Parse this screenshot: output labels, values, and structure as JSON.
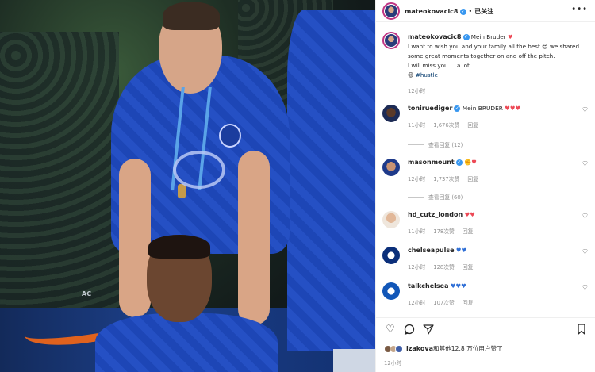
{
  "post": {
    "author": "mateokovacic8",
    "follow_status": "已关注",
    "dot": "•",
    "caption_lines": [
      "Mein Bruder",
      "I want to wish you and your family all the best",
      "we shared some great moments together on and off the pitch.",
      "I will miss you ... a lot"
    ],
    "hashtag": "#hustle",
    "caption_time": "12小时",
    "photo_watermark": "AC"
  },
  "comments": [
    {
      "user": "toniruediger",
      "verified": true,
      "text": "Mein BRUDER",
      "emoji": "♥♥♥",
      "emoji_color": "#ed4956",
      "time": "11小时",
      "likes": "1,676次赞",
      "reply": "回复",
      "view_replies": "查看回复 (12)"
    },
    {
      "user": "masonmount",
      "verified": true,
      "text": "",
      "emoji": "✊♥",
      "emoji_color": "#ed4956",
      "time": "12小时",
      "likes": "1,737次赞",
      "reply": "回复",
      "view_replies": "查看回复 (60)"
    },
    {
      "user": "hd_cutz_london",
      "verified": false,
      "text": "",
      "emoji": "♥♥",
      "emoji_color": "#ed4956",
      "time": "11小时",
      "likes": "178次赞",
      "reply": "回复"
    },
    {
      "user": "chelseapulse",
      "verified": false,
      "text": "",
      "emoji": "♥♥",
      "emoji_color": "#2f6fd6",
      "time": "12小时",
      "likes": "128次赞",
      "reply": "回复"
    },
    {
      "user": "talkchelsea",
      "verified": false,
      "text": "",
      "emoji": "♥♥♥",
      "emoji_color": "#2f6fd6",
      "time": "12小时",
      "likes": "107次赞",
      "reply": "回复"
    }
  ],
  "actions": {
    "like_icon": "heart-outline",
    "comment_icon": "speech-bubble",
    "share_icon": "paper-plane",
    "save_icon": "bookmark"
  },
  "likes_summary": {
    "first_user": "izakova",
    "text": "和其他12.8 万位用户赞了"
  },
  "post_time": "12小时",
  "colors": {
    "verified": "#3897f0",
    "link": "#00376b",
    "muted": "#8e8e8e",
    "heart": "#ed4956",
    "chelsea_blue": "#2f6fd6"
  }
}
